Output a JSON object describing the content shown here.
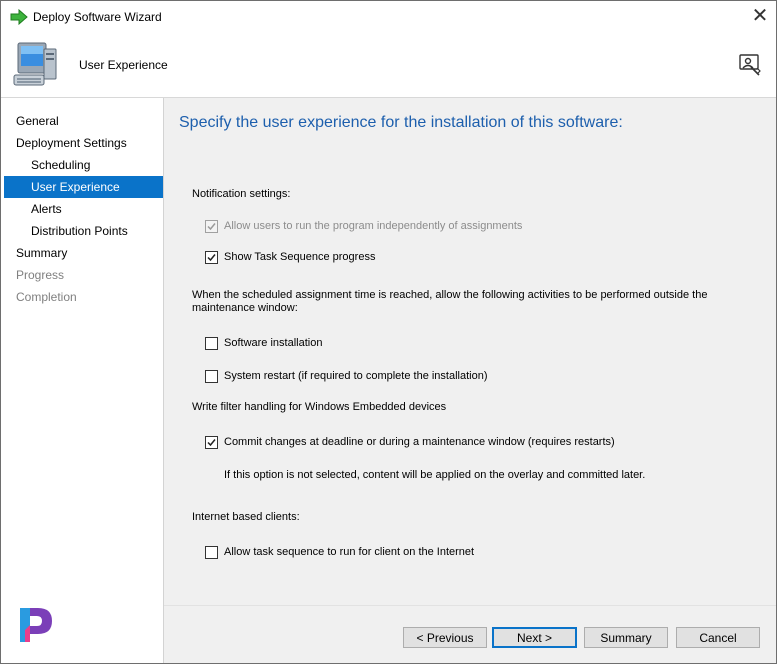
{
  "window": {
    "title": "Deploy Software Wizard",
    "close_glyph": "✕",
    "icons": [
      "green-arrow-icon",
      "computer-icon",
      "help-user-icon",
      "close-icon"
    ]
  },
  "header": {
    "title": "User Experience"
  },
  "sidebar": {
    "items": [
      {
        "label": "General",
        "state": "normal"
      },
      {
        "label": "Deployment Settings",
        "state": "normal"
      },
      {
        "label": "Scheduling",
        "state": "normal"
      },
      {
        "label": "User Experience",
        "state": "active"
      },
      {
        "label": "Alerts",
        "state": "normal"
      },
      {
        "label": "Distribution Points",
        "state": "normal"
      },
      {
        "label": "Summary",
        "state": "normal"
      },
      {
        "label": "Progress",
        "state": "disabled"
      },
      {
        "label": "Completion",
        "state": "disabled"
      }
    ]
  },
  "content": {
    "title": "Specify the user experience for the installation of this software:",
    "notification_heading": "Notification settings:",
    "allow_independent": {
      "label": "Allow users to run the program independently of assignments",
      "checked": true,
      "enabled": false
    },
    "show_progress": {
      "label": "Show Task Sequence progress",
      "checked": true,
      "enabled": true
    },
    "maintenance_heading": "When the scheduled assignment time is reached, allow the following activities to be performed outside the",
    "maintenance_heading_2": "maintenance window:",
    "software_install": {
      "label": "Software installation",
      "checked": false,
      "enabled": true
    },
    "system_restart": {
      "label": "System restart (if required to complete the installation)",
      "checked": false,
      "enabled": true
    },
    "write_filter_heading": "Write filter handling for Windows Embedded devices",
    "commit_changes": {
      "label": "Commit changes at deadline or during a maintenance window (requires restarts)",
      "checked": true,
      "enabled": true
    },
    "commit_note": "If this option is not selected, content will be applied on the overlay and committed later.",
    "internet_heading": "Internet based clients:",
    "allow_internet": {
      "label": "Allow task sequence to run for client on the Internet",
      "checked": false,
      "enabled": true
    }
  },
  "buttons": {
    "previous": "< Previous",
    "next": "Next >",
    "summary": "Summary",
    "cancel": "Cancel"
  },
  "colors": {
    "accent": "#0a73c9",
    "title_blue": "#1d5fad",
    "content_bg": "#f0f0f0"
  }
}
